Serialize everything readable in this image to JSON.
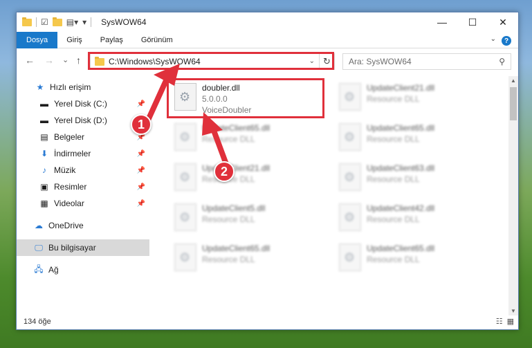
{
  "window": {
    "title": "SysWOW64",
    "controls": {
      "minimize": "—",
      "maximize": "☐",
      "close": "✕"
    }
  },
  "ribbon": {
    "tabs": [
      "Dosya",
      "Giriş",
      "Paylaş",
      "Görünüm"
    ],
    "help": "?"
  },
  "navigation": {
    "back": "←",
    "forward": "→",
    "recent": "⌄",
    "up": "↑",
    "address": "C:\\Windows\\SysWOW64",
    "refresh": "↻",
    "search_placeholder": "Ara: SysWOW64"
  },
  "sidebar": {
    "items": [
      {
        "label": "Hızlı erişim",
        "icon": "star-icon"
      },
      {
        "label": "Yerel Disk (C:)",
        "icon": "drive-icon",
        "pinned": true
      },
      {
        "label": "Yerel Disk (D:)",
        "icon": "drive-icon",
        "pinned": true
      },
      {
        "label": "Belgeler",
        "icon": "document-icon",
        "pinned": true
      },
      {
        "label": "İndirmeler",
        "icon": "download-icon",
        "pinned": true
      },
      {
        "label": "Müzik",
        "icon": "music-icon",
        "pinned": true
      },
      {
        "label": "Resimler",
        "icon": "pictures-icon",
        "pinned": true
      },
      {
        "label": "Videolar",
        "icon": "video-icon",
        "pinned": true
      },
      {
        "label": "OneDrive",
        "icon": "cloud-icon"
      },
      {
        "label": "Bu bilgisayar",
        "icon": "computer-icon",
        "selected": true
      },
      {
        "label": "Ağ",
        "icon": "network-icon"
      }
    ]
  },
  "files": [
    {
      "name": "doubler.dll",
      "version": "5.0.0.0",
      "desc": "VoiceDoubler",
      "highlighted": true
    },
    {
      "name": "UpdateClient21.dll",
      "desc": "Resource DLL"
    },
    {
      "name": "UpdateClient65.dll",
      "desc": "Resource DLL"
    },
    {
      "name": "UpdateClient65.dll",
      "desc": "Resource DLL"
    },
    {
      "name": "UpdateClient21.dll",
      "desc": "Resource DLL"
    },
    {
      "name": "UpdateClient63.dll",
      "desc": "Resource DLL"
    },
    {
      "name": "UpdateClient5.dll",
      "desc": "Resource DLL"
    },
    {
      "name": "UpdateClient42.dll",
      "desc": "Resource DLL"
    },
    {
      "name": "UpdateClient65.dll",
      "desc": "Resource DLL"
    },
    {
      "name": "UpdateClient65.dll",
      "desc": "Resource DLL"
    }
  ],
  "status": {
    "count": "134 öğe"
  },
  "annotations": {
    "step1": "1",
    "step2": "2",
    "color": "#e0303b"
  }
}
